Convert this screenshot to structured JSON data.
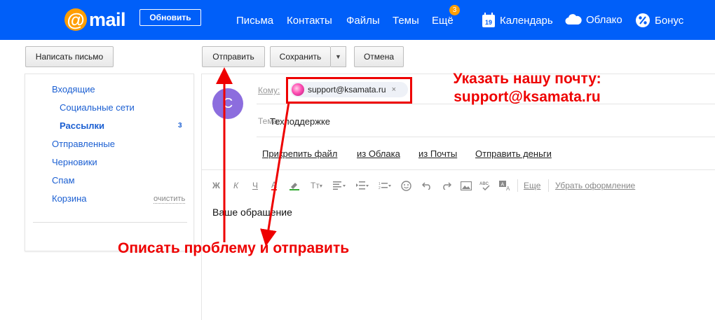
{
  "topbar": {
    "logo_text": "mail",
    "update_button": "Обновить",
    "nav": [
      "Письма",
      "Контакты",
      "Файлы",
      "Темы",
      "Ещё"
    ],
    "more_badge": "3",
    "calendar": "Календарь",
    "calendar_day": "19",
    "cloud": "Облако",
    "bonus": "Бонус",
    "bg_color": "#005ff9",
    "accent_color": "#ff9e00"
  },
  "toolbar": {
    "compose": "Написать письмо",
    "send": "Отправить",
    "save": "Сохранить",
    "cancel": "Отмена"
  },
  "sidebar": {
    "folders": [
      {
        "label": "Входящие"
      },
      {
        "label": "Социальные сети"
      },
      {
        "label": "Рассылки",
        "count": "3"
      },
      {
        "label": "Отправленные"
      },
      {
        "label": "Черновики"
      },
      {
        "label": "Спам"
      },
      {
        "label": "Корзина",
        "action": "очистить"
      }
    ]
  },
  "compose": {
    "avatar_letter": "С",
    "to_label": "Кому:",
    "recipient": "support@ksamata.ru",
    "subject_label": "Тема:",
    "subject": "Техподдержке",
    "attach_links": [
      "Прикрепить файл",
      "из Облака",
      "из Почты",
      "Отправить деньги"
    ],
    "format_tools": [
      "Ж",
      "К",
      "Ч",
      "A",
      "T",
      "Tт"
    ],
    "more_tool": "Еще",
    "clear_format": "Убрать оформление",
    "body": "Ваше обращение"
  },
  "annotations": {
    "note_email_line1": "Указать нашу почту:",
    "note_email_line2": "support@ksamata.ru",
    "note_describe": "Описать проблему и отправить",
    "color": "#e00000"
  }
}
